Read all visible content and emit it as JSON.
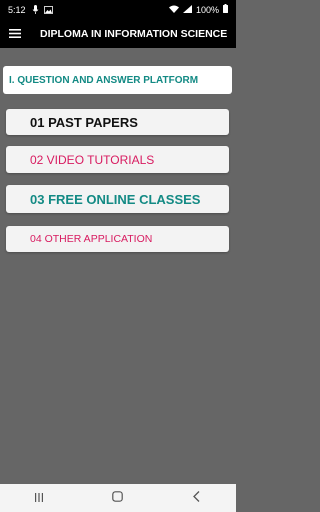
{
  "status_bar": {
    "time": "5:12",
    "battery": "100%"
  },
  "app_bar": {
    "title": "DIPLOMA IN INFORMATION SCIENCE"
  },
  "header": {
    "label": "I. QUESTION AND ANSWER PLATFORM"
  },
  "menu_items": [
    {
      "label": "01 PAST PAPERS"
    },
    {
      "label": "02 VIDEO TUTORIALS"
    },
    {
      "label": "03 FREE ONLINE CLASSES"
    },
    {
      "label": "04 OTHER APPLICATION"
    }
  ],
  "icons": {
    "menu": "hamburger-menu-icon",
    "nav_recent": "recent-apps-icon",
    "nav_home": "home-icon",
    "nav_back": "back-icon"
  },
  "colors": {
    "background": "#666666",
    "teal": "#138a84",
    "pink": "#d81b60"
  }
}
